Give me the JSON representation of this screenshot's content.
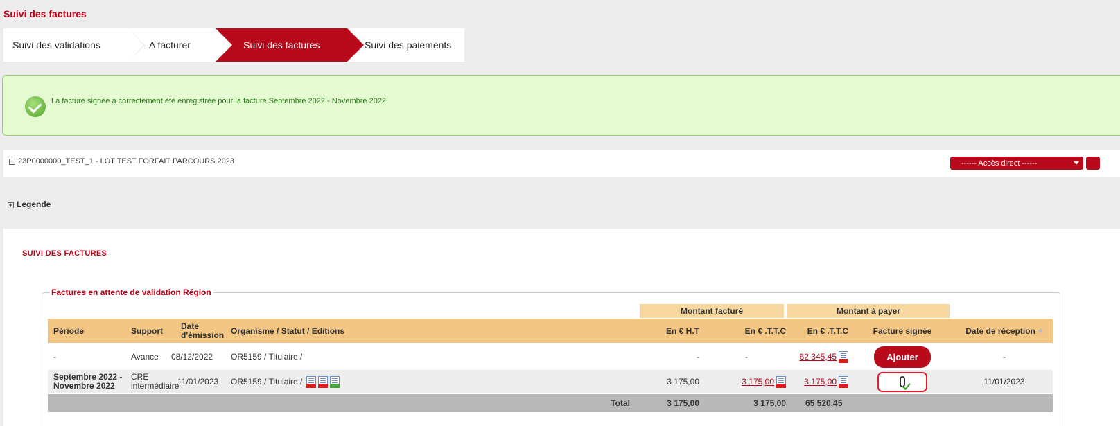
{
  "page_title": "Suivi des factures",
  "steps": [
    {
      "label": "Suivi des validations",
      "active": false
    },
    {
      "label": "A facturer",
      "active": false
    },
    {
      "label": "Suivi des factures",
      "active": true
    },
    {
      "label": "Suivi des paiements",
      "active": false
    }
  ],
  "alert": {
    "message": "La facture signée a correctement été enregistrée pour la facture Septembre 2022 - Novembre 2022.",
    "icon": "check-circle-icon"
  },
  "lot": {
    "label": "23P0000000_TEST_1 - LOT TEST FORFAIT PARCOURS 2023",
    "acces_direct": "------ Accès direct ------"
  },
  "legende": "Legende",
  "section_title": "SUIVI DES FACTURES",
  "fieldset_title": "Factures en attente de validation Région",
  "group_headers": {
    "montant_facture": "Montant facturé",
    "montant_a_payer": "Montant à payer"
  },
  "columns": {
    "periode": "Période",
    "support": "Support",
    "date_emission_1": "Date",
    "date_emission_2": "d'émission",
    "organisme": "Organisme / Statut / Editions",
    "ht": "En € H.T",
    "ttc": "En € .T.T.C",
    "ttc_payer": "En € .T.T.C",
    "facture_signee": "Facture signée",
    "date_reception": "Date de réception"
  },
  "rows": [
    {
      "periode": "-",
      "support": "Avance",
      "date_emission": "08/12/2022",
      "organisme": "OR5159 / Titulaire /",
      "ht": "-",
      "ttc": "-",
      "ttc_payer": "62 345,45",
      "facture_signee_action": "Ajouter",
      "date_reception": "-"
    },
    {
      "periode_1": "Septembre 2022 -",
      "periode_2": "Novembre 2022",
      "support_1": "CRE",
      "support_2": "intermédiaire",
      "date_emission": "11/01/2023",
      "organisme": "OR5159 / Titulaire /",
      "ht": "3 175,00",
      "ttc": "3 175,00",
      "ttc_payer": "3 175,00",
      "facture_signee_icon": "paperclip-icon",
      "date_reception": "11/01/2023"
    }
  ],
  "total": {
    "label": "Total",
    "ht": "3 175,00",
    "ttc": "3 175,00",
    "ttc_payer": "65 520,45"
  },
  "colors": {
    "brand_red": "#b90a1c",
    "header_orange": "#f3c684",
    "alert_green": "#e4fbd2"
  }
}
